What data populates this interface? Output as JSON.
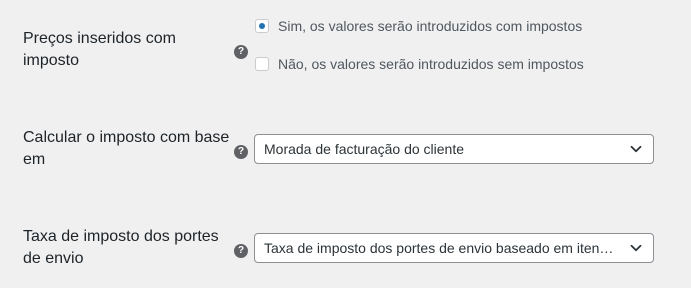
{
  "prices_entered": {
    "label": "Preços inseridos com imposto",
    "help_icon": "question-circle-icon",
    "help_glyph": "?",
    "options": [
      {
        "label": "Sim, os valores serão introduzidos com impostos",
        "checked": true
      },
      {
        "label": "Não, os valores serão introduzidos sem impostos",
        "checked": false
      }
    ]
  },
  "calculate_based_on": {
    "label": "Calcular o imposto com base em",
    "help_icon": "question-circle-icon",
    "help_glyph": "?",
    "selected": "Morada de facturação do cliente",
    "dropdown_icon": "chevron-down-icon"
  },
  "shipping_tax_class": {
    "label": "Taxa de imposto dos portes de envio",
    "help_icon": "question-circle-icon",
    "help_glyph": "?",
    "selected": "Taxa de imposto dos portes de envio baseado em iten…",
    "dropdown_icon": "chevron-down-icon"
  },
  "colors": {
    "accent": "#2271b1",
    "background": "#f0f0f1",
    "text": "#1d2327"
  }
}
